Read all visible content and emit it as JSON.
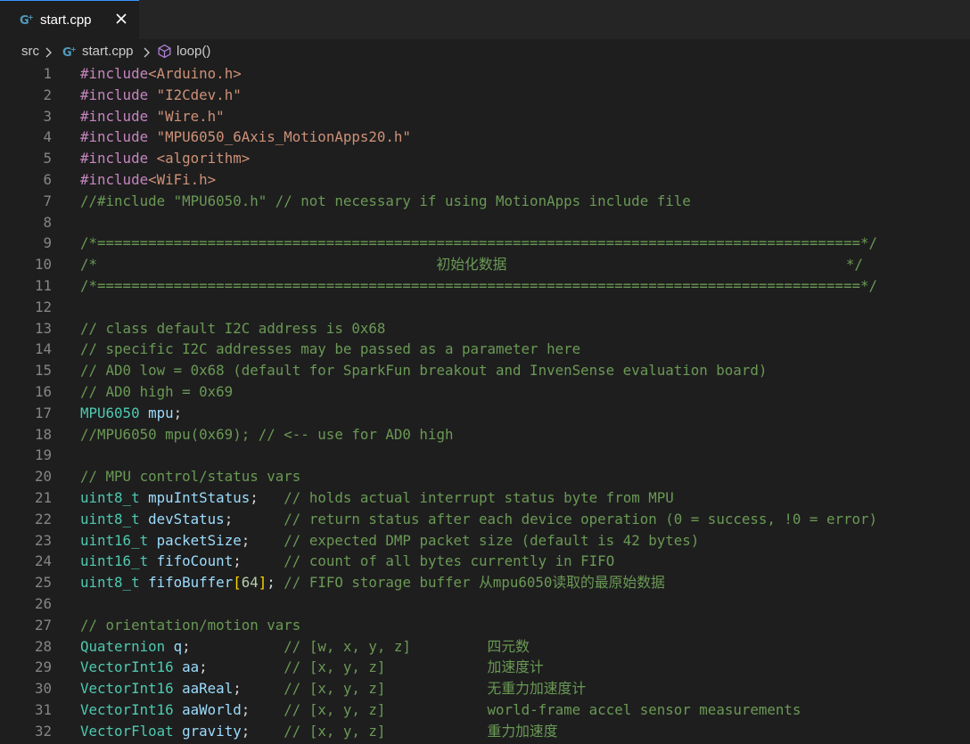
{
  "tab": {
    "label": "start.cpp"
  },
  "breadcrumb": {
    "folder": "src",
    "file": "start.cpp",
    "symbol": "loop()"
  },
  "lines": [
    {
      "n": "1",
      "tokens": [
        {
          "c": "kw",
          "t": "#include"
        },
        {
          "c": "str",
          "t": "<Arduino.h>"
        }
      ]
    },
    {
      "n": "2",
      "tokens": [
        {
          "c": "kw",
          "t": "#include "
        },
        {
          "c": "str",
          "t": "\"I2Cdev.h\""
        }
      ]
    },
    {
      "n": "3",
      "tokens": [
        {
          "c": "kw",
          "t": "#include "
        },
        {
          "c": "str",
          "t": "\"Wire.h\""
        }
      ]
    },
    {
      "n": "4",
      "tokens": [
        {
          "c": "kw",
          "t": "#include "
        },
        {
          "c": "str",
          "t": "\"MPU6050_6Axis_MotionApps20.h\""
        }
      ]
    },
    {
      "n": "5",
      "tokens": [
        {
          "c": "kw",
          "t": "#include "
        },
        {
          "c": "str",
          "t": "<algorithm>"
        }
      ]
    },
    {
      "n": "6",
      "tokens": [
        {
          "c": "kw",
          "t": "#include"
        },
        {
          "c": "str",
          "t": "<WiFi.h>"
        }
      ]
    },
    {
      "n": "7",
      "tokens": [
        {
          "c": "cm",
          "t": "//#include \"MPU6050.h\" // not necessary if using MotionApps include file"
        }
      ]
    },
    {
      "n": "8",
      "tokens": []
    },
    {
      "n": "9",
      "tokens": [
        {
          "c": "cm",
          "t": "/*==========================================================================================*/"
        }
      ]
    },
    {
      "n": "10",
      "tokens": [
        {
          "c": "cm",
          "t": "/*                                        初始化数据                                        */"
        }
      ]
    },
    {
      "n": "11",
      "tokens": [
        {
          "c": "cm",
          "t": "/*==========================================================================================*/"
        }
      ]
    },
    {
      "n": "12",
      "tokens": []
    },
    {
      "n": "13",
      "tokens": [
        {
          "c": "cm",
          "t": "// class default I2C address is 0x68"
        }
      ]
    },
    {
      "n": "14",
      "tokens": [
        {
          "c": "cm",
          "t": "// specific I2C addresses may be passed as a parameter here"
        }
      ]
    },
    {
      "n": "15",
      "tokens": [
        {
          "c": "cm",
          "t": "// AD0 low = 0x68 (default for SparkFun breakout and InvenSense evaluation board)"
        }
      ]
    },
    {
      "n": "16",
      "tokens": [
        {
          "c": "cm",
          "t": "// AD0 high = 0x69"
        }
      ]
    },
    {
      "n": "17",
      "tokens": [
        {
          "c": "ty",
          "t": "MPU6050"
        },
        {
          "c": "pl",
          "t": " "
        },
        {
          "c": "var",
          "t": "mpu"
        },
        {
          "c": "pl",
          "t": ";"
        }
      ]
    },
    {
      "n": "18",
      "tokens": [
        {
          "c": "cm",
          "t": "//MPU6050 mpu(0x69); // <-- use for AD0 high"
        }
      ]
    },
    {
      "n": "19",
      "tokens": []
    },
    {
      "n": "20",
      "tokens": [
        {
          "c": "cm",
          "t": "// MPU control/status vars"
        }
      ]
    },
    {
      "n": "21",
      "tokens": [
        {
          "c": "ty",
          "t": "uint8_t"
        },
        {
          "c": "pl",
          "t": " "
        },
        {
          "c": "var",
          "t": "mpuIntStatus"
        },
        {
          "c": "pl",
          "t": ";   "
        },
        {
          "c": "cm",
          "t": "// holds actual interrupt status byte from MPU"
        }
      ]
    },
    {
      "n": "22",
      "tokens": [
        {
          "c": "ty",
          "t": "uint8_t"
        },
        {
          "c": "pl",
          "t": " "
        },
        {
          "c": "var",
          "t": "devStatus"
        },
        {
          "c": "pl",
          "t": ";      "
        },
        {
          "c": "cm",
          "t": "// return status after each device operation (0 = success, !0 = error)"
        }
      ]
    },
    {
      "n": "23",
      "tokens": [
        {
          "c": "ty",
          "t": "uint16_t"
        },
        {
          "c": "pl",
          "t": " "
        },
        {
          "c": "var",
          "t": "packetSize"
        },
        {
          "c": "pl",
          "t": ";    "
        },
        {
          "c": "cm",
          "t": "// expected DMP packet size (default is 42 bytes)"
        }
      ]
    },
    {
      "n": "24",
      "tokens": [
        {
          "c": "ty",
          "t": "uint16_t"
        },
        {
          "c": "pl",
          "t": " "
        },
        {
          "c": "var",
          "t": "fifoCount"
        },
        {
          "c": "pl",
          "t": ";     "
        },
        {
          "c": "cm",
          "t": "// count of all bytes currently in FIFO"
        }
      ]
    },
    {
      "n": "25",
      "tokens": [
        {
          "c": "ty",
          "t": "uint8_t"
        },
        {
          "c": "pl",
          "t": " "
        },
        {
          "c": "var",
          "t": "fifoBuffer"
        },
        {
          "c": "br",
          "t": "["
        },
        {
          "c": "num",
          "t": "64"
        },
        {
          "c": "br",
          "t": "]"
        },
        {
          "c": "pl",
          "t": "; "
        },
        {
          "c": "cm",
          "t": "// FIFO storage buffer 从mpu6050读取的最原始数据"
        }
      ]
    },
    {
      "n": "26",
      "tokens": []
    },
    {
      "n": "27",
      "tokens": [
        {
          "c": "cm",
          "t": "// orientation/motion vars"
        }
      ]
    },
    {
      "n": "28",
      "tokens": [
        {
          "c": "ty",
          "t": "Quaternion"
        },
        {
          "c": "pl",
          "t": " "
        },
        {
          "c": "var",
          "t": "q"
        },
        {
          "c": "pl",
          "t": ";           "
        },
        {
          "c": "cm",
          "t": "// [w, x, y, z]         四元数"
        }
      ]
    },
    {
      "n": "29",
      "tokens": [
        {
          "c": "ty",
          "t": "VectorInt16"
        },
        {
          "c": "pl",
          "t": " "
        },
        {
          "c": "var",
          "t": "aa"
        },
        {
          "c": "pl",
          "t": ";         "
        },
        {
          "c": "cm",
          "t": "// [x, y, z]            加速度计"
        }
      ]
    },
    {
      "n": "30",
      "tokens": [
        {
          "c": "ty",
          "t": "VectorInt16"
        },
        {
          "c": "pl",
          "t": " "
        },
        {
          "c": "var",
          "t": "aaReal"
        },
        {
          "c": "pl",
          "t": ";     "
        },
        {
          "c": "cm",
          "t": "// [x, y, z]            无重力加速度计"
        }
      ]
    },
    {
      "n": "31",
      "tokens": [
        {
          "c": "ty",
          "t": "VectorInt16"
        },
        {
          "c": "pl",
          "t": " "
        },
        {
          "c": "var",
          "t": "aaWorld"
        },
        {
          "c": "pl",
          "t": ";    "
        },
        {
          "c": "cm",
          "t": "// [x, y, z]            world-frame accel sensor measurements"
        }
      ]
    },
    {
      "n": "32",
      "tokens": [
        {
          "c": "ty",
          "t": "VectorFloat"
        },
        {
          "c": "pl",
          "t": " "
        },
        {
          "c": "var",
          "t": "gravity"
        },
        {
          "c": "pl",
          "t": ";    "
        },
        {
          "c": "cm",
          "t": "// [x, y, z]            重力加速度"
        }
      ]
    }
  ]
}
